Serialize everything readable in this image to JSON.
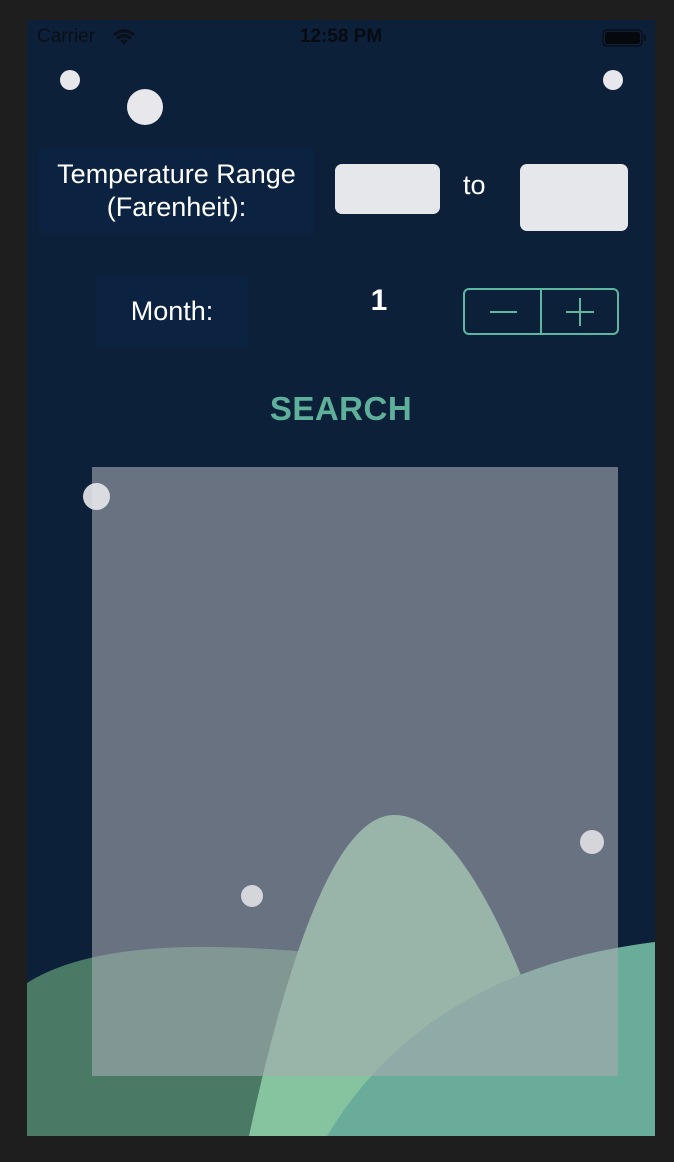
{
  "status_bar": {
    "carrier": "Carrier",
    "time": "12:58 PM"
  },
  "temperature": {
    "label_line1": "Temperature Range",
    "label_line2": "(Farenheit):",
    "min_value": "",
    "max_value": "",
    "separator": "to"
  },
  "month": {
    "label": "Month:",
    "value": "1",
    "decrement_symbol": "−",
    "increment_symbol": "+"
  },
  "search": {
    "label": "SEARCH"
  },
  "colors": {
    "background": "#0d203a",
    "label_box": "#0b2340",
    "accent": "#5db7a0",
    "field": "#e6e7ea"
  },
  "icons": [
    "wifi-icon",
    "battery-icon",
    "minus-icon",
    "plus-icon"
  ]
}
